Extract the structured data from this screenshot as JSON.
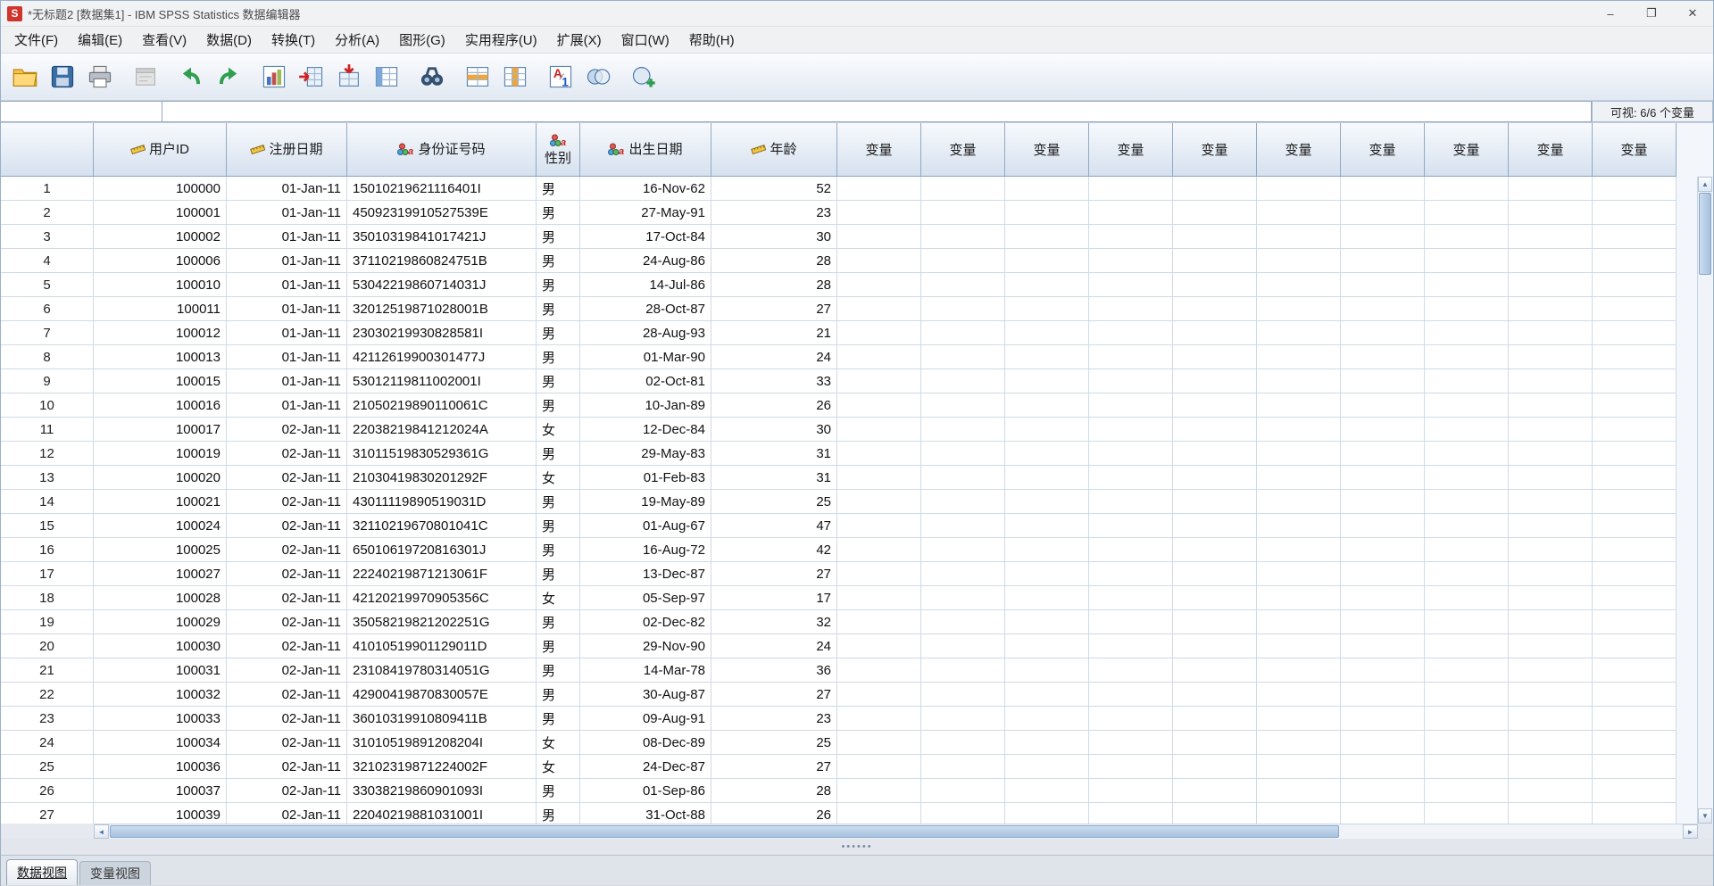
{
  "window": {
    "title": "*无标题2 [数据集1] - IBM SPSS Statistics 数据编辑器",
    "controls": {
      "minimize": "–",
      "maximize": "❐",
      "close": "✕"
    }
  },
  "menu": {
    "items": [
      {
        "label": "文件(F)"
      },
      {
        "label": "编辑(E)"
      },
      {
        "label": "查看(V)"
      },
      {
        "label": "数据(D)"
      },
      {
        "label": "转换(T)"
      },
      {
        "label": "分析(A)"
      },
      {
        "label": "图形(G)"
      },
      {
        "label": "实用程序(U)"
      },
      {
        "label": "扩展(X)"
      },
      {
        "label": "窗口(W)"
      },
      {
        "label": "帮助(H)"
      }
    ]
  },
  "toolbar": {
    "icons": [
      "open-data",
      "save",
      "print",
      "recall-dialogs",
      "undo",
      "redo",
      "goto-chart",
      "goto-case",
      "goto-variable",
      "variables",
      "find",
      "insert-cases",
      "insert-variable",
      "value-labels",
      "use-variable-sets",
      "show-all-variables"
    ]
  },
  "editbar": {
    "name_box_value": "",
    "cell_editor_value": "",
    "visible_vars": "可视: 6/6 个变量"
  },
  "grid": {
    "columns": [
      {
        "label": "用户ID",
        "icon": "scale-measure",
        "type": "numeric"
      },
      {
        "label": "注册日期",
        "icon": "scale-measure",
        "type": "date"
      },
      {
        "label": "身份证号码",
        "icon": "nominal-string",
        "type": "string"
      },
      {
        "label": "性别",
        "icon": "nominal-string",
        "type": "string"
      },
      {
        "label": "出生日期",
        "icon": "nominal-string",
        "type": "string"
      },
      {
        "label": "年龄",
        "icon": "scale-measure",
        "type": "numeric"
      }
    ],
    "placeholder_columns": [
      "变量",
      "变量",
      "变量",
      "变量",
      "变量",
      "变量",
      "变量",
      "变量",
      "变量",
      "变量"
    ],
    "rows": [
      {
        "num": "1",
        "id": "100000",
        "reg": "01-Jan-11",
        "idcard": "15010219621116401I",
        "sex": "男",
        "birth": "16-Nov-62",
        "age": "52"
      },
      {
        "num": "2",
        "id": "100001",
        "reg": "01-Jan-11",
        "idcard": "45092319910527539E",
        "sex": "男",
        "birth": "27-May-91",
        "age": "23"
      },
      {
        "num": "3",
        "id": "100002",
        "reg": "01-Jan-11",
        "idcard": "35010319841017421J",
        "sex": "男",
        "birth": "17-Oct-84",
        "age": "30"
      },
      {
        "num": "4",
        "id": "100006",
        "reg": "01-Jan-11",
        "idcard": "37110219860824751B",
        "sex": "男",
        "birth": "24-Aug-86",
        "age": "28"
      },
      {
        "num": "5",
        "id": "100010",
        "reg": "01-Jan-11",
        "idcard": "53042219860714031J",
        "sex": "男",
        "birth": "14-Jul-86",
        "age": "28"
      },
      {
        "num": "6",
        "id": "100011",
        "reg": "01-Jan-11",
        "idcard": "32012519871028001B",
        "sex": "男",
        "birth": "28-Oct-87",
        "age": "27"
      },
      {
        "num": "7",
        "id": "100012",
        "reg": "01-Jan-11",
        "idcard": "23030219930828581I",
        "sex": "男",
        "birth": "28-Aug-93",
        "age": "21"
      },
      {
        "num": "8",
        "id": "100013",
        "reg": "01-Jan-11",
        "idcard": "42112619900301477J",
        "sex": "男",
        "birth": "01-Mar-90",
        "age": "24"
      },
      {
        "num": "9",
        "id": "100015",
        "reg": "01-Jan-11",
        "idcard": "53012119811002001I",
        "sex": "男",
        "birth": "02-Oct-81",
        "age": "33"
      },
      {
        "num": "10",
        "id": "100016",
        "reg": "01-Jan-11",
        "idcard": "21050219890110061C",
        "sex": "男",
        "birth": "10-Jan-89",
        "age": "26"
      },
      {
        "num": "11",
        "id": "100017",
        "reg": "02-Jan-11",
        "idcard": "22038219841212024A",
        "sex": "女",
        "birth": "12-Dec-84",
        "age": "30"
      },
      {
        "num": "12",
        "id": "100019",
        "reg": "02-Jan-11",
        "idcard": "31011519830529361G",
        "sex": "男",
        "birth": "29-May-83",
        "age": "31"
      },
      {
        "num": "13",
        "id": "100020",
        "reg": "02-Jan-11",
        "idcard": "21030419830201292F",
        "sex": "女",
        "birth": "01-Feb-83",
        "age": "31"
      },
      {
        "num": "14",
        "id": "100021",
        "reg": "02-Jan-11",
        "idcard": "43011119890519031D",
        "sex": "男",
        "birth": "19-May-89",
        "age": "25"
      },
      {
        "num": "15",
        "id": "100024",
        "reg": "02-Jan-11",
        "idcard": "32110219670801041C",
        "sex": "男",
        "birth": "01-Aug-67",
        "age": "47"
      },
      {
        "num": "16",
        "id": "100025",
        "reg": "02-Jan-11",
        "idcard": "65010619720816301J",
        "sex": "男",
        "birth": "16-Aug-72",
        "age": "42"
      },
      {
        "num": "17",
        "id": "100027",
        "reg": "02-Jan-11",
        "idcard": "22240219871213061F",
        "sex": "男",
        "birth": "13-Dec-87",
        "age": "27"
      },
      {
        "num": "18",
        "id": "100028",
        "reg": "02-Jan-11",
        "idcard": "42120219970905356C",
        "sex": "女",
        "birth": "05-Sep-97",
        "age": "17"
      },
      {
        "num": "19",
        "id": "100029",
        "reg": "02-Jan-11",
        "idcard": "35058219821202251G",
        "sex": "男",
        "birth": "02-Dec-82",
        "age": "32"
      },
      {
        "num": "20",
        "id": "100030",
        "reg": "02-Jan-11",
        "idcard": "41010519901129011D",
        "sex": "男",
        "birth": "29-Nov-90",
        "age": "24"
      },
      {
        "num": "21",
        "id": "100031",
        "reg": "02-Jan-11",
        "idcard": "23108419780314051G",
        "sex": "男",
        "birth": "14-Mar-78",
        "age": "36"
      },
      {
        "num": "22",
        "id": "100032",
        "reg": "02-Jan-11",
        "idcard": "42900419870830057E",
        "sex": "男",
        "birth": "30-Aug-87",
        "age": "27"
      },
      {
        "num": "23",
        "id": "100033",
        "reg": "02-Jan-11",
        "idcard": "36010319910809411B",
        "sex": "男",
        "birth": "09-Aug-91",
        "age": "23"
      },
      {
        "num": "24",
        "id": "100034",
        "reg": "02-Jan-11",
        "idcard": "31010519891208204I",
        "sex": "女",
        "birth": "08-Dec-89",
        "age": "25"
      },
      {
        "num": "25",
        "id": "100036",
        "reg": "02-Jan-11",
        "idcard": "32102319871224002F",
        "sex": "女",
        "birth": "24-Dec-87",
        "age": "27"
      },
      {
        "num": "26",
        "id": "100037",
        "reg": "02-Jan-11",
        "idcard": "33038219860901093I",
        "sex": "男",
        "birth": "01-Sep-86",
        "age": "28"
      },
      {
        "num": "27",
        "id": "100039",
        "reg": "02-Jan-11",
        "idcard": "22040219881031001I",
        "sex": "男",
        "birth": "31-Oct-88",
        "age": "26"
      }
    ]
  },
  "tabs": [
    {
      "label": "数据视图",
      "active": true
    },
    {
      "label": "变量视图",
      "active": false
    }
  ],
  "colors": {
    "accent_blue": "#4a76a8",
    "header_gradient_top": "#f7fafd",
    "header_gradient_bottom": "#d6e1ef",
    "grid_line": "#cfdae8",
    "brand_red": "#d0342c"
  }
}
